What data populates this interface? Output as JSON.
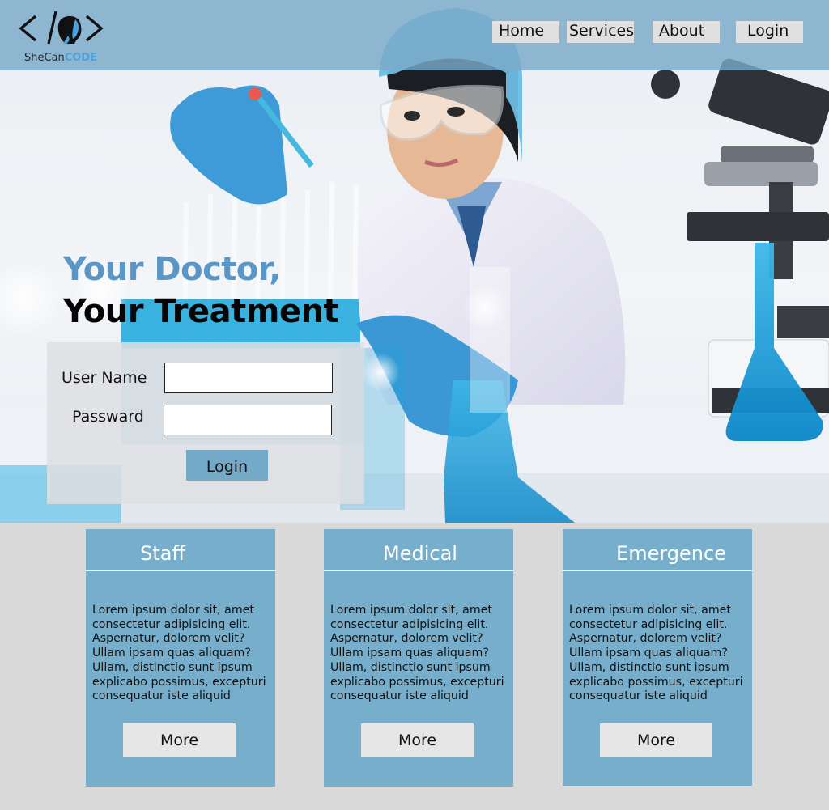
{
  "brand": {
    "name_part1": "SheCan",
    "name_part2": "CODE"
  },
  "nav": {
    "home": "Home",
    "services": "Services",
    "about": "About",
    "login": "Login"
  },
  "hero": {
    "headline_line1": "Your Doctor,",
    "headline_line2": "Your Treatment"
  },
  "login_form": {
    "username_label": "User Name",
    "username_value": "",
    "password_label": "Passward",
    "password_value": "",
    "submit_label": "Login"
  },
  "cards": [
    {
      "title": "Staff",
      "body": " Lorem ipsum dolor sit, amet\nconsectetur adipisicing elit.\n Aspernatur, dolorem velit?\nUllam ipsam quas aliquam?\nUllam, distinctio sunt ipsum\nexplicabo possimus, excepturi\nconsequatur iste aliquid",
      "button": "More"
    },
    {
      "title": "Medical",
      "body": " Lorem ipsum dolor sit, amet\nconsectetur adipisicing elit.\n Aspernatur, dolorem velit?\nUllam ipsam quas aliquam?\nUllam, distinctio sunt ipsum\nexplicabo possimus, excepturi\nconsequatur iste aliquid",
      "button": "More"
    },
    {
      "title": "Emergence",
      "body": " Lorem ipsum dolor sit, amet\nconsectetur adipisicing elit.\n Aspernatur, dolorem velit?\nUllam ipsam quas aliquam?\nUllam, distinctio sunt ipsum\nexplicabo possimus, excepturi\nconsequatur iste aliquid",
      "button": "More"
    }
  ],
  "colors": {
    "header_bg": "#7aaac8",
    "accent_blue": "#5b97c6",
    "card_bg": "#76aecb",
    "button_light": "#e0e0e0",
    "page_bg": "#d9d9d9"
  },
  "icons": [
    "code-brackets-icon",
    "woman-profile-icon"
  ]
}
